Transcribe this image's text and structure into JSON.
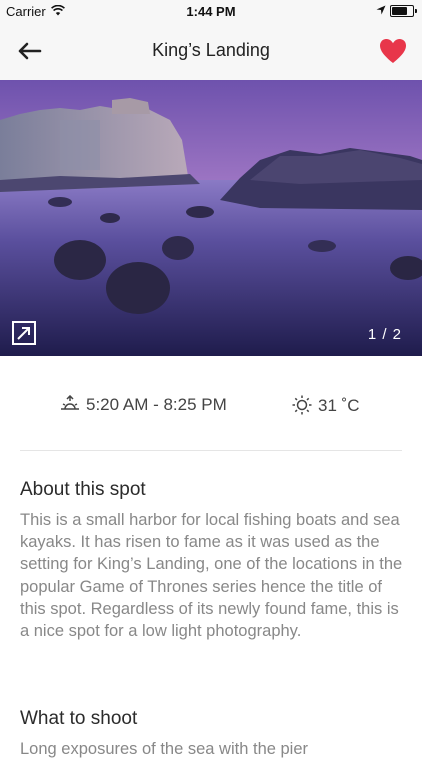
{
  "status_bar": {
    "carrier": "Carrier",
    "time": "1:44 PM",
    "battery_level": 0.85
  },
  "nav": {
    "title": "King’s Landing",
    "favorited": true
  },
  "gallery": {
    "counter": "1 / 2",
    "current": 1,
    "total": 2
  },
  "info": {
    "sun_times": "5:20 AM - 8:25 PM",
    "temperature": "31 ˚C"
  },
  "sections": [
    {
      "title": "About this spot",
      "body": "This is a small harbor for local fishing boats and sea kayaks. It has risen to fame as it was used as the setting for King’s Landing, one of the locations in the popular Game of Thrones series hence the title of this spot. Regardless of its newly found fame, this is a nice spot for a low light photography."
    },
    {
      "title": "What to shoot",
      "body": "Long exposures of the sea with the pier"
    }
  ],
  "colors": {
    "heart": "#e8364a",
    "sky_top": "#7c5fb8",
    "sky_bottom": "#e3a7d6",
    "water": "#3a3470"
  }
}
